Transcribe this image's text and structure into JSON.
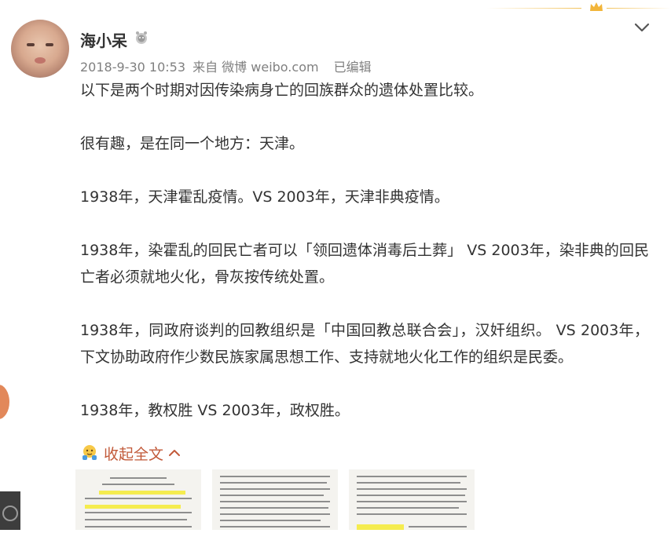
{
  "user": {
    "name": "海小呆",
    "badge_icon": "vip-badge-icon"
  },
  "meta": {
    "time": "2018-9-30 10:53",
    "source": "来自 微博 weibo.com",
    "edited": "已编辑"
  },
  "post": {
    "paragraphs": [
      "以下是两个时期对因传染病身亡的回族群众的遗体处置比较。",
      "很有趣，是在同一个地方：天津。",
      "1938年，天津霍乱疫情。VS 2003年，天津非典疫情。",
      "1938年，染霍乱的回民亡者可以「领回遗体消毒后土葬」 VS 2003年，染非典的回民亡者必须就地火化，骨灰按传统处置。",
      "1938年，同政府谈判的回教组织是「中国回教总联合会」，汉奸组织。 VS  2003年，下文协助政府作少数民族家属思想工作、支持就地火化工作的组织是民委。",
      "1938年，教权胜  VS  2003年，政权胜。"
    ]
  },
  "actions": {
    "collapse_label": "收起全文"
  },
  "colors": {
    "accent": "#c25a3a",
    "gold": "#f2c25a",
    "meta": "#808080"
  }
}
